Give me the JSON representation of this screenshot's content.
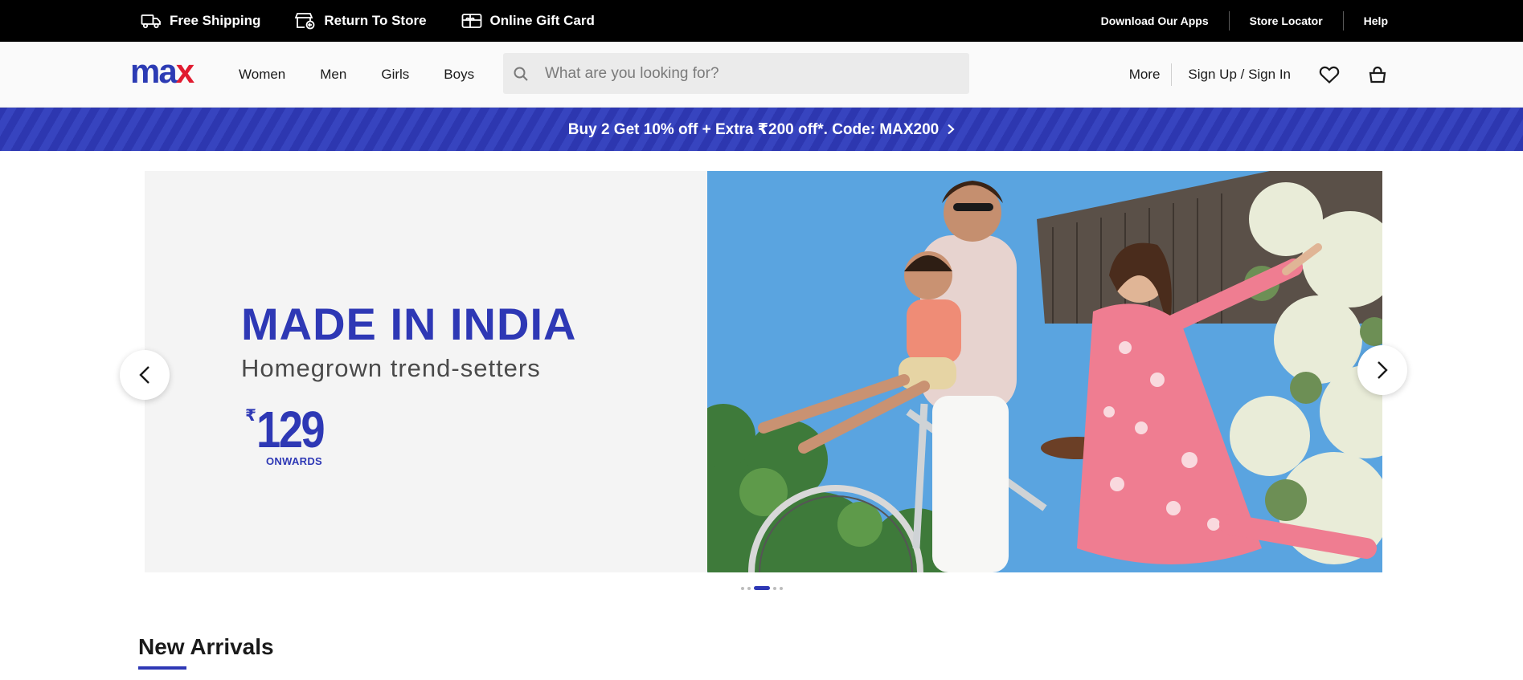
{
  "utility_bar": {
    "left_items": [
      {
        "label": "Free Shipping",
        "icon": "truck-icon"
      },
      {
        "label": "Return To Store",
        "icon": "return-store-icon"
      },
      {
        "label": "Online Gift Card",
        "icon": "gift-card-icon"
      }
    ],
    "right_links": [
      "Download Our Apps",
      "Store Locator",
      "Help"
    ]
  },
  "header": {
    "logo": {
      "part1": "ma",
      "part2": "x"
    },
    "nav": [
      "Women",
      "Men",
      "Girls",
      "Boys"
    ],
    "search": {
      "placeholder": "What are you looking for?",
      "value": ""
    },
    "more_label": "More",
    "signin_label": "Sign Up / Sign In",
    "icons": [
      "heart-icon",
      "bag-icon"
    ]
  },
  "promo": {
    "text": "Buy 2 Get 10% off + Extra ₹200 off*. Code: MAX200"
  },
  "hero": {
    "headline": "MADE IN INDIA",
    "subheadline": "Homegrown trend-setters",
    "currency": "₹",
    "price": "129",
    "price_suffix": "ONWARDS",
    "slide_count": 5,
    "active_slide": 3
  },
  "section": {
    "title": "New Arrivals"
  },
  "colors": {
    "brand_blue": "#2e38b5",
    "brand_red": "#e11b30",
    "utility_bg": "#000000"
  }
}
